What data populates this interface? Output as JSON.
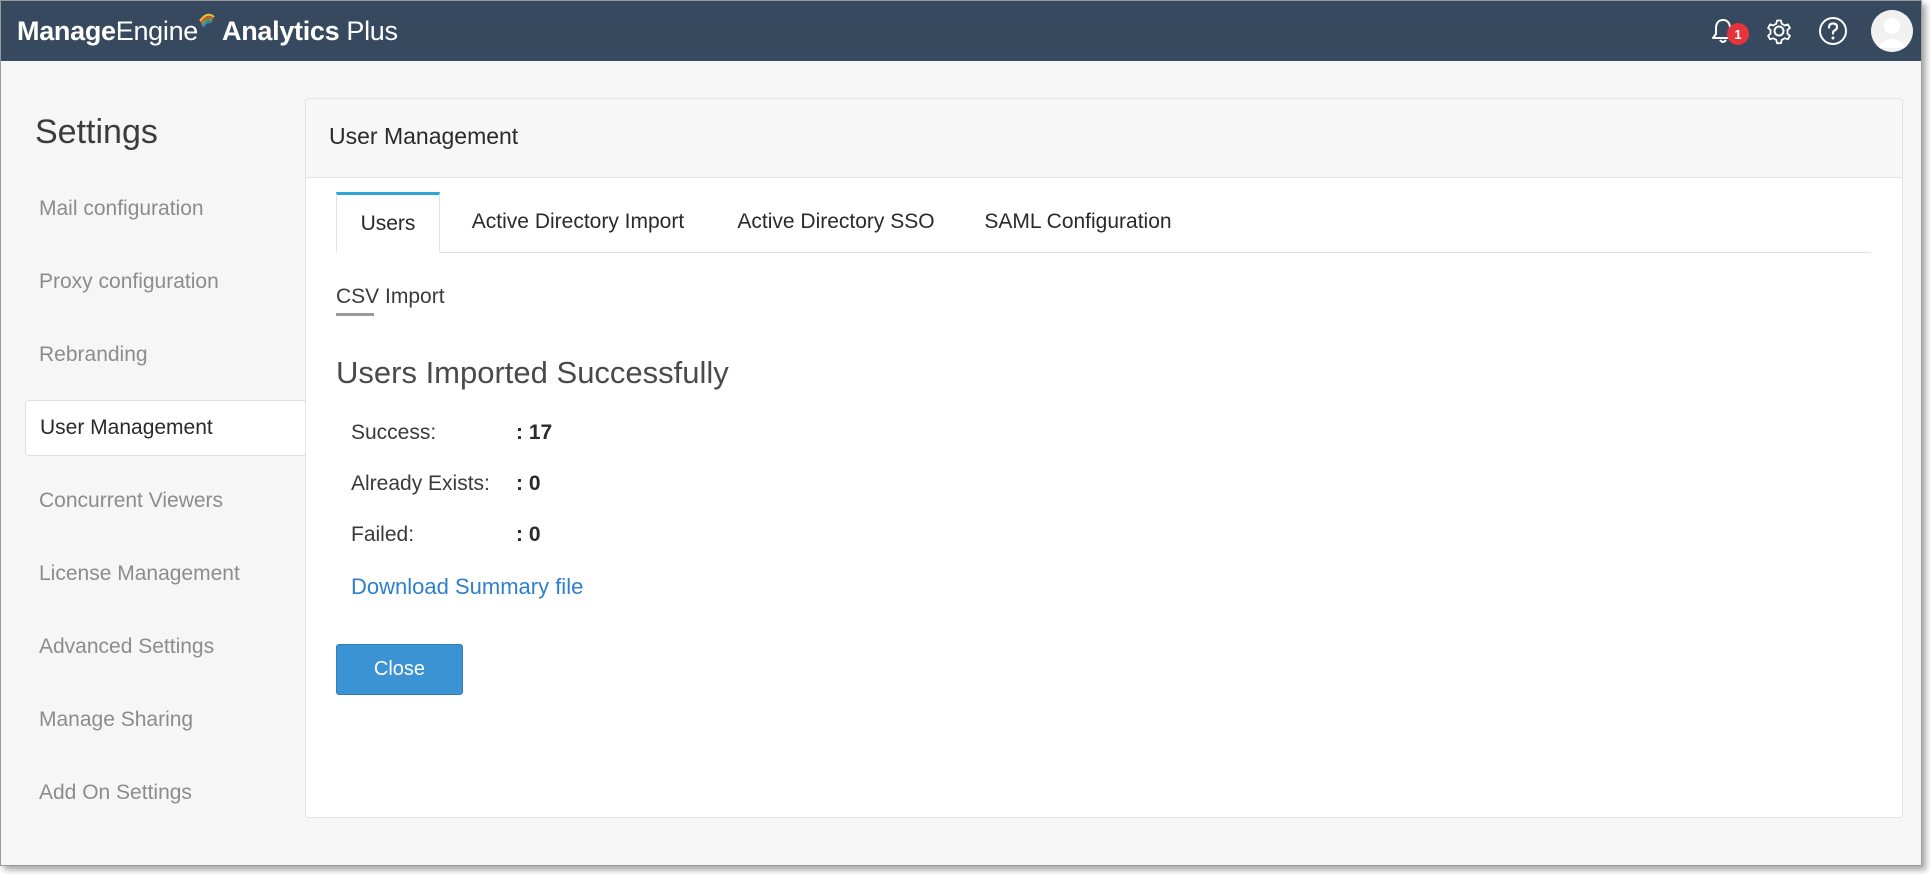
{
  "header": {
    "brand_part1": "Manage",
    "brand_part2": "Engine",
    "brand_part3": "Analytics",
    "brand_part4": "Plus",
    "notification_count": "1",
    "icons": [
      "bell-icon",
      "gear-icon",
      "help-icon",
      "avatar"
    ],
    "bg_color": "#36495e"
  },
  "sidebar": {
    "title": "Settings",
    "items": [
      {
        "label": "Mail configuration"
      },
      {
        "label": "Proxy configuration"
      },
      {
        "label": "Rebranding"
      },
      {
        "label": "User Management",
        "active": true
      },
      {
        "label": "Concurrent Viewers"
      },
      {
        "label": "License Management"
      },
      {
        "label": "Advanced Settings"
      },
      {
        "label": "Manage Sharing"
      },
      {
        "label": "Add On Settings"
      }
    ]
  },
  "main": {
    "title": "User Management",
    "tabs": [
      {
        "label": "Users",
        "active": true
      },
      {
        "label": "Active Directory Import"
      },
      {
        "label": "Active Directory SSO"
      },
      {
        "label": "SAML Configuration"
      }
    ],
    "subtab": "CSV Import",
    "heading": "Users Imported Successfully",
    "results": [
      {
        "label": "Success:",
        "value": ": 17"
      },
      {
        "label": "Already Exists:",
        "value": ": 0"
      },
      {
        "label": "Failed:",
        "value": ": 0"
      }
    ],
    "download_link": "Download Summary file",
    "close_label": "Close",
    "accent_color": "#2ea6d3",
    "button_color": "#3b93d3",
    "link_color": "#2f80c9"
  }
}
